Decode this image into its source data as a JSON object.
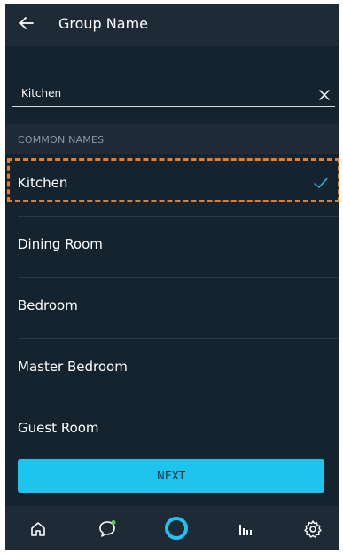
{
  "header": {
    "title": "Group Name",
    "back_icon": "arrow-left-icon"
  },
  "name_field": {
    "value": "Kitchen",
    "clear_icon": "close-icon"
  },
  "section": {
    "label": "COMMON NAMES"
  },
  "common_names": [
    {
      "label": "Kitchen",
      "selected": true
    },
    {
      "label": "Dining Room",
      "selected": false
    },
    {
      "label": "Bedroom",
      "selected": false
    },
    {
      "label": "Master Bedroom",
      "selected": false
    },
    {
      "label": "Guest Room",
      "selected": false
    }
  ],
  "next_button": {
    "label": "NEXT"
  },
  "bottom_nav": {
    "items": [
      {
        "icon": "home-icon"
      },
      {
        "icon": "chat-icon"
      },
      {
        "icon": "alexa-icon"
      },
      {
        "icon": "play-icon"
      },
      {
        "icon": "settings-icon"
      }
    ]
  },
  "colors": {
    "background": "#15232f",
    "header": "#1e2b37",
    "accent": "#1ec3ee",
    "highlight": "#f07a1c",
    "check": "#1ec3ee"
  }
}
